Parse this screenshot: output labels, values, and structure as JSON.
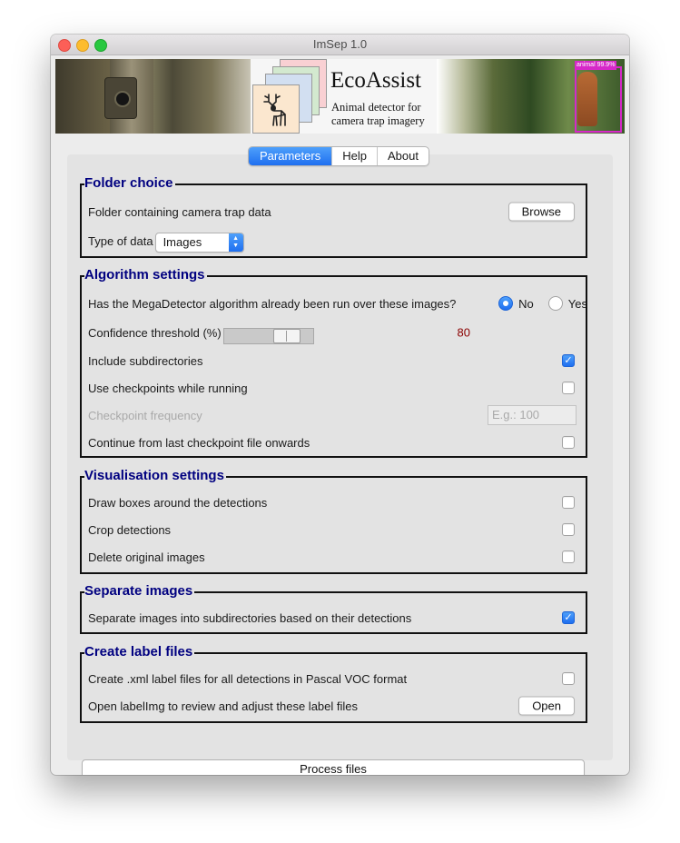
{
  "window": {
    "title": "ImSep 1.0"
  },
  "banner": {
    "logo_title": "EcoAssist",
    "logo_subtitle_line1": "Animal detector for",
    "logo_subtitle_line2": "camera trap imagery",
    "detection_label": "animal 99.9%"
  },
  "tabs": [
    {
      "label": "Parameters",
      "active": true
    },
    {
      "label": "Help",
      "active": false
    },
    {
      "label": "About",
      "active": false
    }
  ],
  "folder_choice": {
    "title": "Folder choice",
    "folder_label": "Folder containing camera trap data",
    "browse_label": "Browse",
    "data_type_label": "Type of data",
    "data_type_value": "Images"
  },
  "algorithm_settings": {
    "title": "Algorithm settings",
    "megadetector_question": "Has the MegaDetector algorithm already been run over these images?",
    "radio_no": "No",
    "radio_yes": "Yes",
    "selected": "No",
    "confidence_label": "Confidence threshold (%)",
    "confidence_value": "80",
    "confidence_fraction": 0.8,
    "subdirs_label": "Include subdirectories",
    "subdirs_checked": true,
    "checkpoints_label": "Use checkpoints while running",
    "checkpoints_checked": false,
    "checkpoint_freq_label": "Checkpoint frequency",
    "checkpoint_freq_placeholder": "E.g.: 100",
    "continue_label": "Continue from last checkpoint file onwards",
    "continue_checked": false
  },
  "visualisation_settings": {
    "title": "Visualisation settings",
    "draw_boxes_label": "Draw boxes around the detections",
    "crop_label": "Crop detections",
    "delete_label": "Delete original images"
  },
  "separate_images": {
    "title": "Separate images",
    "separate_label": "Separate images into subdirectories based on their detections",
    "separate_checked": true
  },
  "label_files": {
    "title": "Create label files",
    "xml_label": "Create .xml label files for all detections in Pascal VOC format",
    "labelimg_label": "Open labelImg to review and adjust these label files",
    "open_label": "Open"
  },
  "process_button_label": "Process files",
  "colors": {
    "accent": "#1f6ff0",
    "section_title": "#000080",
    "threshold_value": "#8b0000"
  }
}
